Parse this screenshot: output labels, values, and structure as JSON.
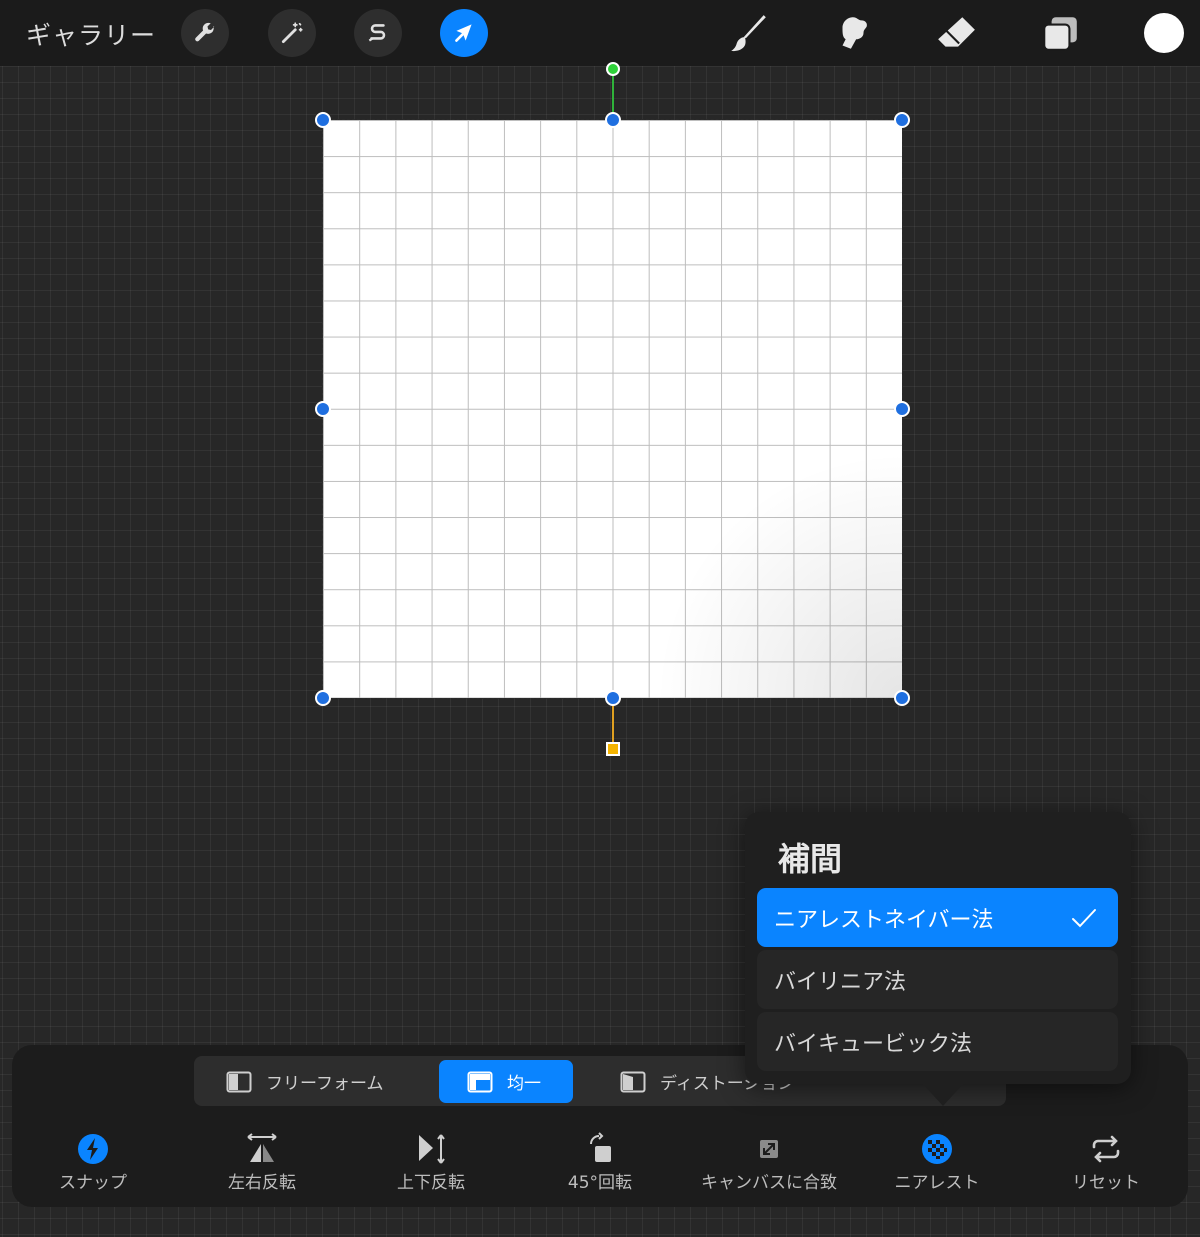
{
  "topbar": {
    "gallery_label": "ギャラリー",
    "left_tools": [
      "wrench-icon",
      "magic-wand-icon",
      "selection-s-icon",
      "transform-arrow-icon"
    ],
    "right_tools": [
      "brush-icon",
      "smudge-icon",
      "eraser-icon",
      "layers-icon"
    ],
    "active_tool": "transform-arrow-icon",
    "current_color": "#ffffff"
  },
  "transform_modes": {
    "items": [
      {
        "label": "フリーフォーム",
        "icon": "freeform-icon"
      },
      {
        "label": "均一",
        "icon": "uniform-icon"
      },
      {
        "label": "ディストーション",
        "icon": "distort-icon"
      }
    ],
    "active": "均一"
  },
  "bottom_tools": [
    {
      "label": "スナップ",
      "icon": "snap-icon"
    },
    {
      "label": "左右反転",
      "icon": "flip-horizontal-icon"
    },
    {
      "label": "上下反転",
      "icon": "flip-vertical-icon"
    },
    {
      "label": "45°回転",
      "icon": "rotate-45-icon"
    },
    {
      "label": "キャンバスに合致",
      "icon": "fit-canvas-icon"
    },
    {
      "label": "ニアレスト",
      "icon": "nearest-icon"
    },
    {
      "label": "リセット",
      "icon": "reset-icon"
    }
  ],
  "interpolation_popover": {
    "title": "補間",
    "options": [
      "ニアレストネイバー法",
      "バイリニア法",
      "バイキュービック法"
    ],
    "selected": "ニアレストネイバー法"
  },
  "colors": {
    "accent": "#0a84ff",
    "handle": "#1f6fe0",
    "rotate_handle": "#2fd13a",
    "pivot_handle": "#f5b400"
  }
}
